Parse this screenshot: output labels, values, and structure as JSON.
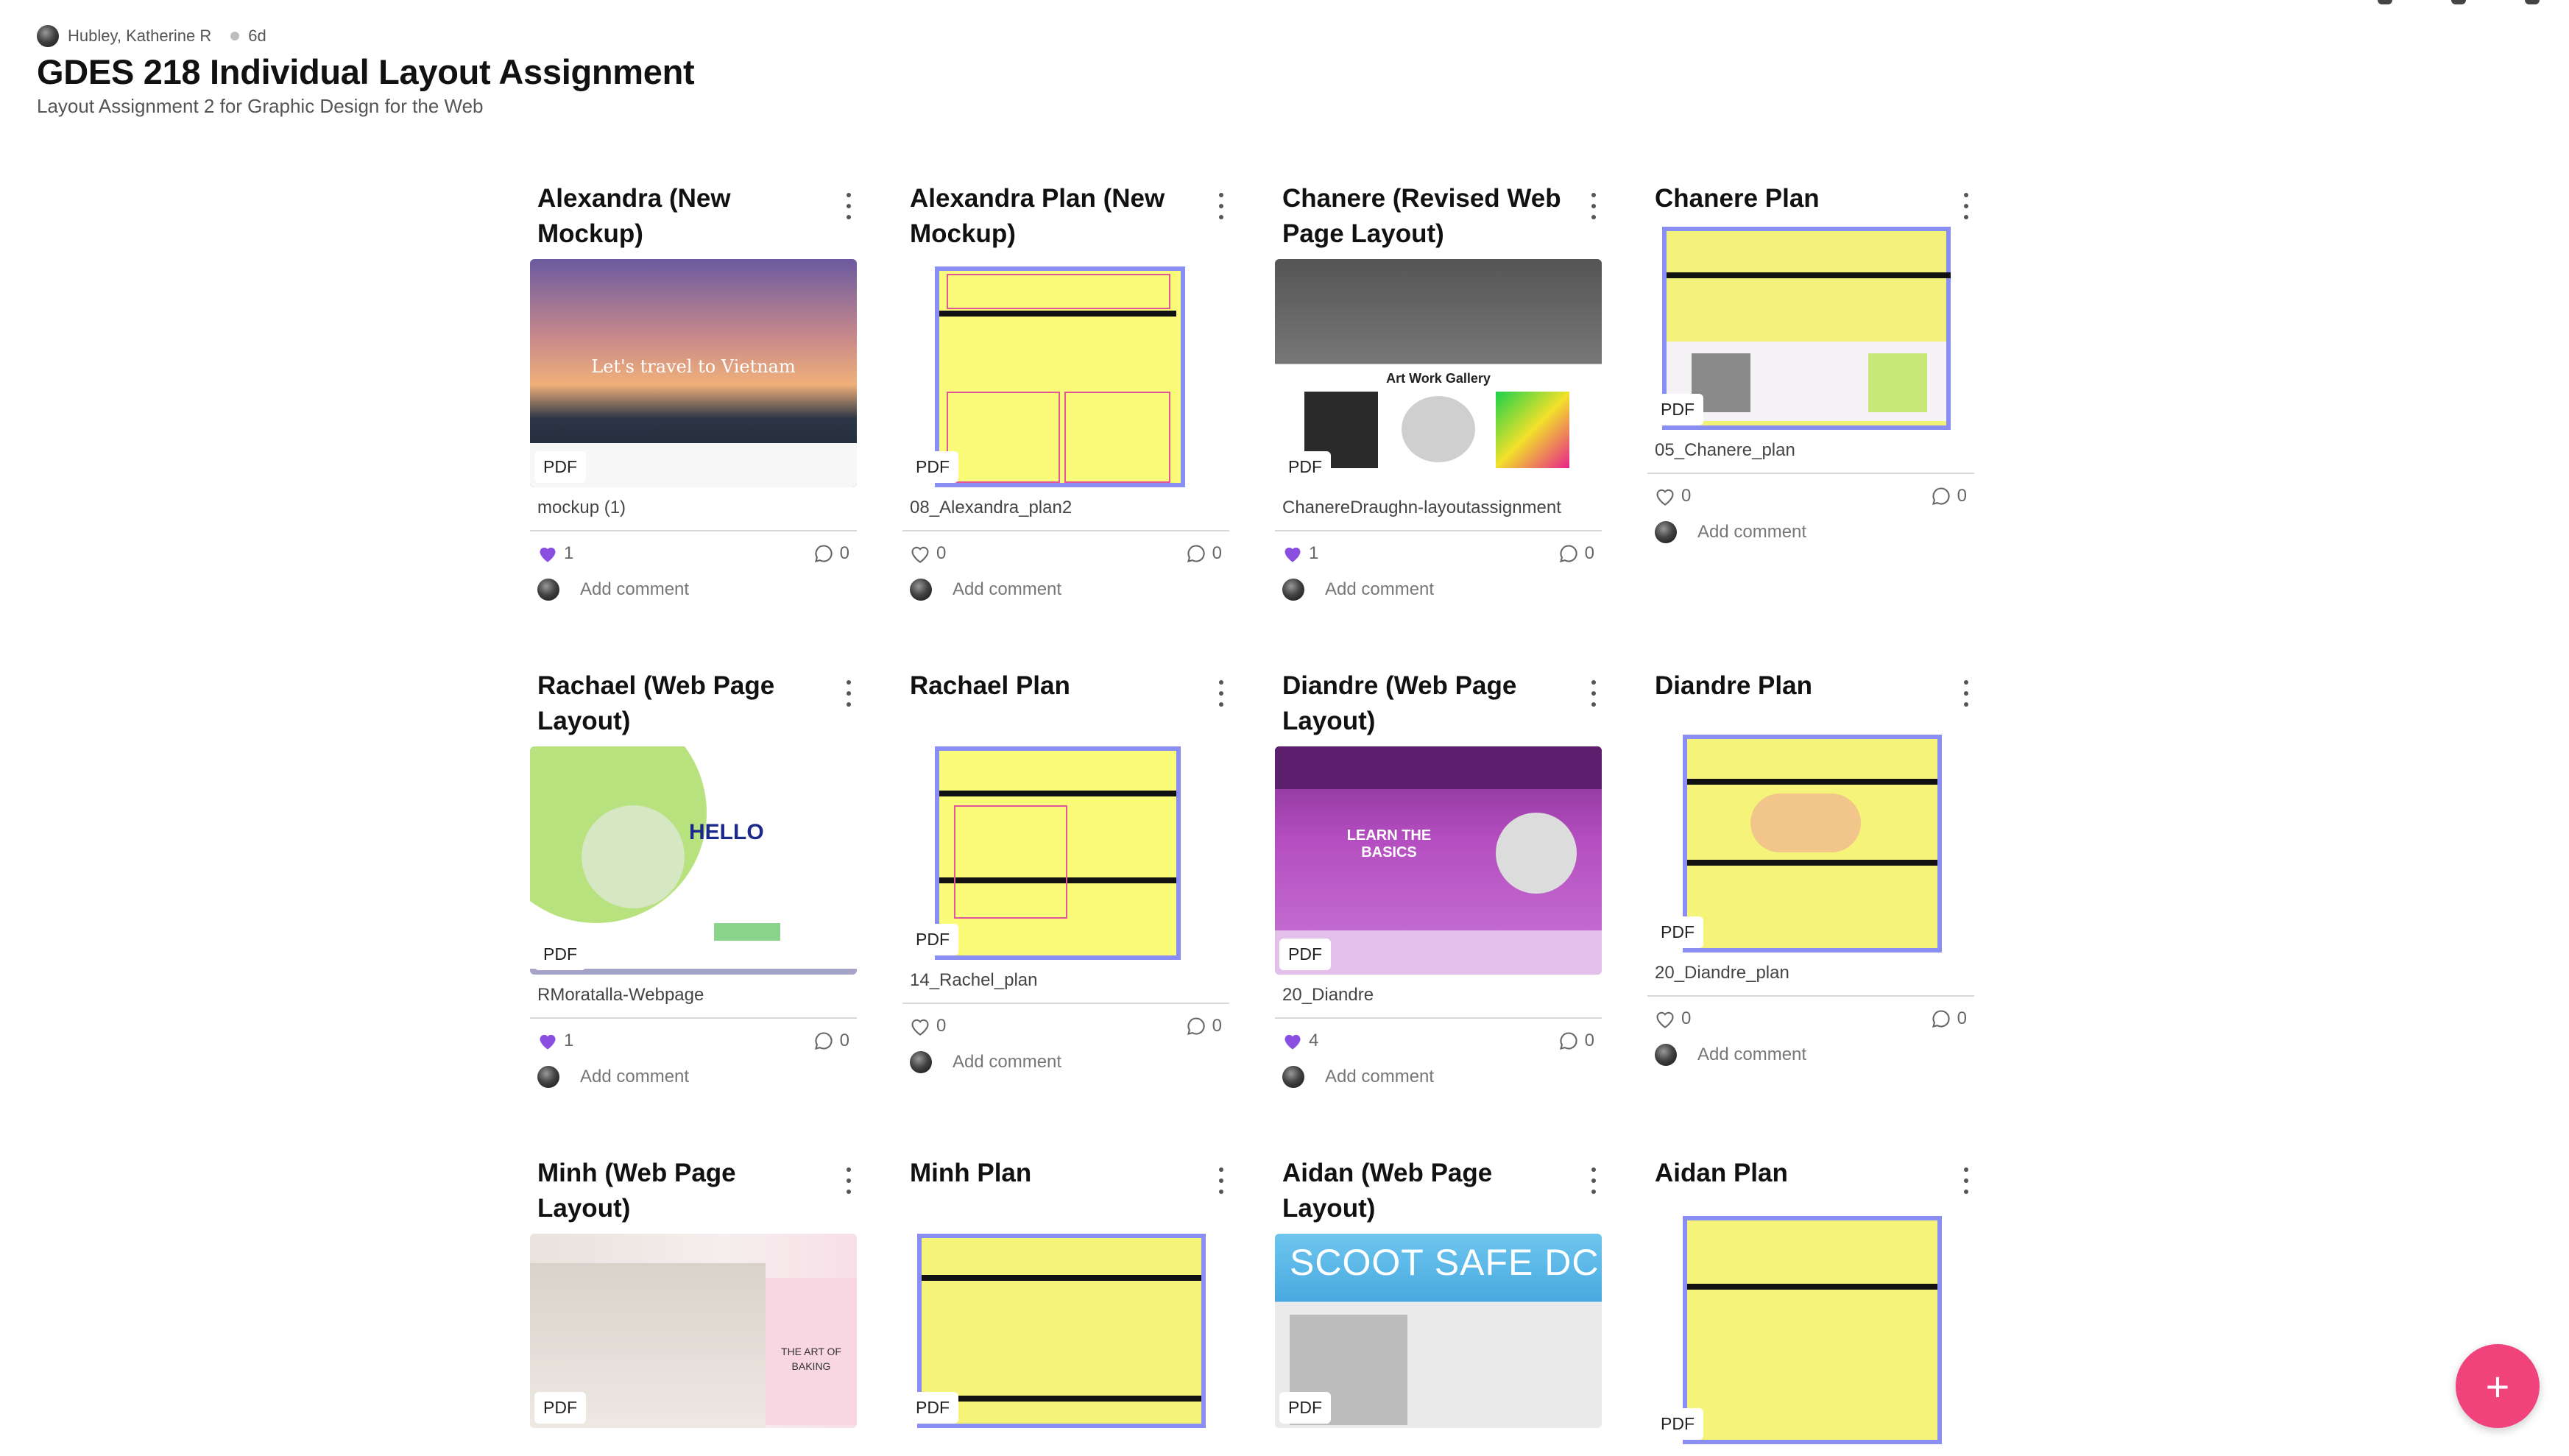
{
  "header": {
    "author": "Hubley, Katherine R",
    "age": "6d",
    "title": "GDES 218 Individual Layout Assignment",
    "subtitle": "Layout Assignment 2 for Graphic Design for the Web"
  },
  "comment_placeholder": "Add comment",
  "colors": {
    "like_active": "#8a4fe0",
    "fab": "#f0427b",
    "plan_yellow": "#fbfb7a",
    "plan_frame": "#8a8ef2"
  },
  "cards": [
    {
      "title": "Alexandra (New Mockup)",
      "badge": "PDF",
      "file": "mockup (1)",
      "likes": "1",
      "liked": true,
      "comments": "0",
      "thumb_text": "Let's travel to Vietnam"
    },
    {
      "title": "Alexandra Plan (New Mockup)",
      "badge": "PDF",
      "file": "08_Alexandra_plan2",
      "likes": "0",
      "liked": false,
      "comments": "0"
    },
    {
      "title": "Chanere (Revised Web Page Layout)",
      "badge": "PDF",
      "file": "ChanereDraughn-layoutassignment",
      "likes": "1",
      "liked": true,
      "comments": "0",
      "thumb_text": "Art Work Gallery"
    },
    {
      "title": "Chanere Plan",
      "badge": "PDF",
      "file": "05_Chanere_plan",
      "likes": "0",
      "liked": false,
      "comments": "0"
    },
    {
      "title": "Rachael (Web Page Layout)",
      "badge": "PDF",
      "file": "RMoratalla-Webpage",
      "likes": "1",
      "liked": true,
      "comments": "0",
      "thumb_text": "HELLO"
    },
    {
      "title": "Rachael Plan",
      "badge": "PDF",
      "file": "14_Rachel_plan",
      "likes": "0",
      "liked": false,
      "comments": "0"
    },
    {
      "title": "Diandre (Web Page Layout)",
      "badge": "PDF",
      "file": "20_Diandre",
      "likes": "4",
      "liked": true,
      "comments": "0",
      "thumb_text": "LEARN THE BASICS"
    },
    {
      "title": "Diandre Plan",
      "badge": "PDF",
      "file": "20_Diandre_plan",
      "likes": "0",
      "liked": false,
      "comments": "0"
    },
    {
      "title": "Minh (Web Page Layout)",
      "badge": "PDF",
      "thumb_text": "THE ART OF BAKING"
    },
    {
      "title": "Minh Plan",
      "badge": "PDF"
    },
    {
      "title": "Aidan (Web Page Layout)",
      "badge": "PDF",
      "thumb_text": "SCOOT SAFE DC"
    },
    {
      "title": "Aidan Plan",
      "badge": "PDF"
    }
  ]
}
